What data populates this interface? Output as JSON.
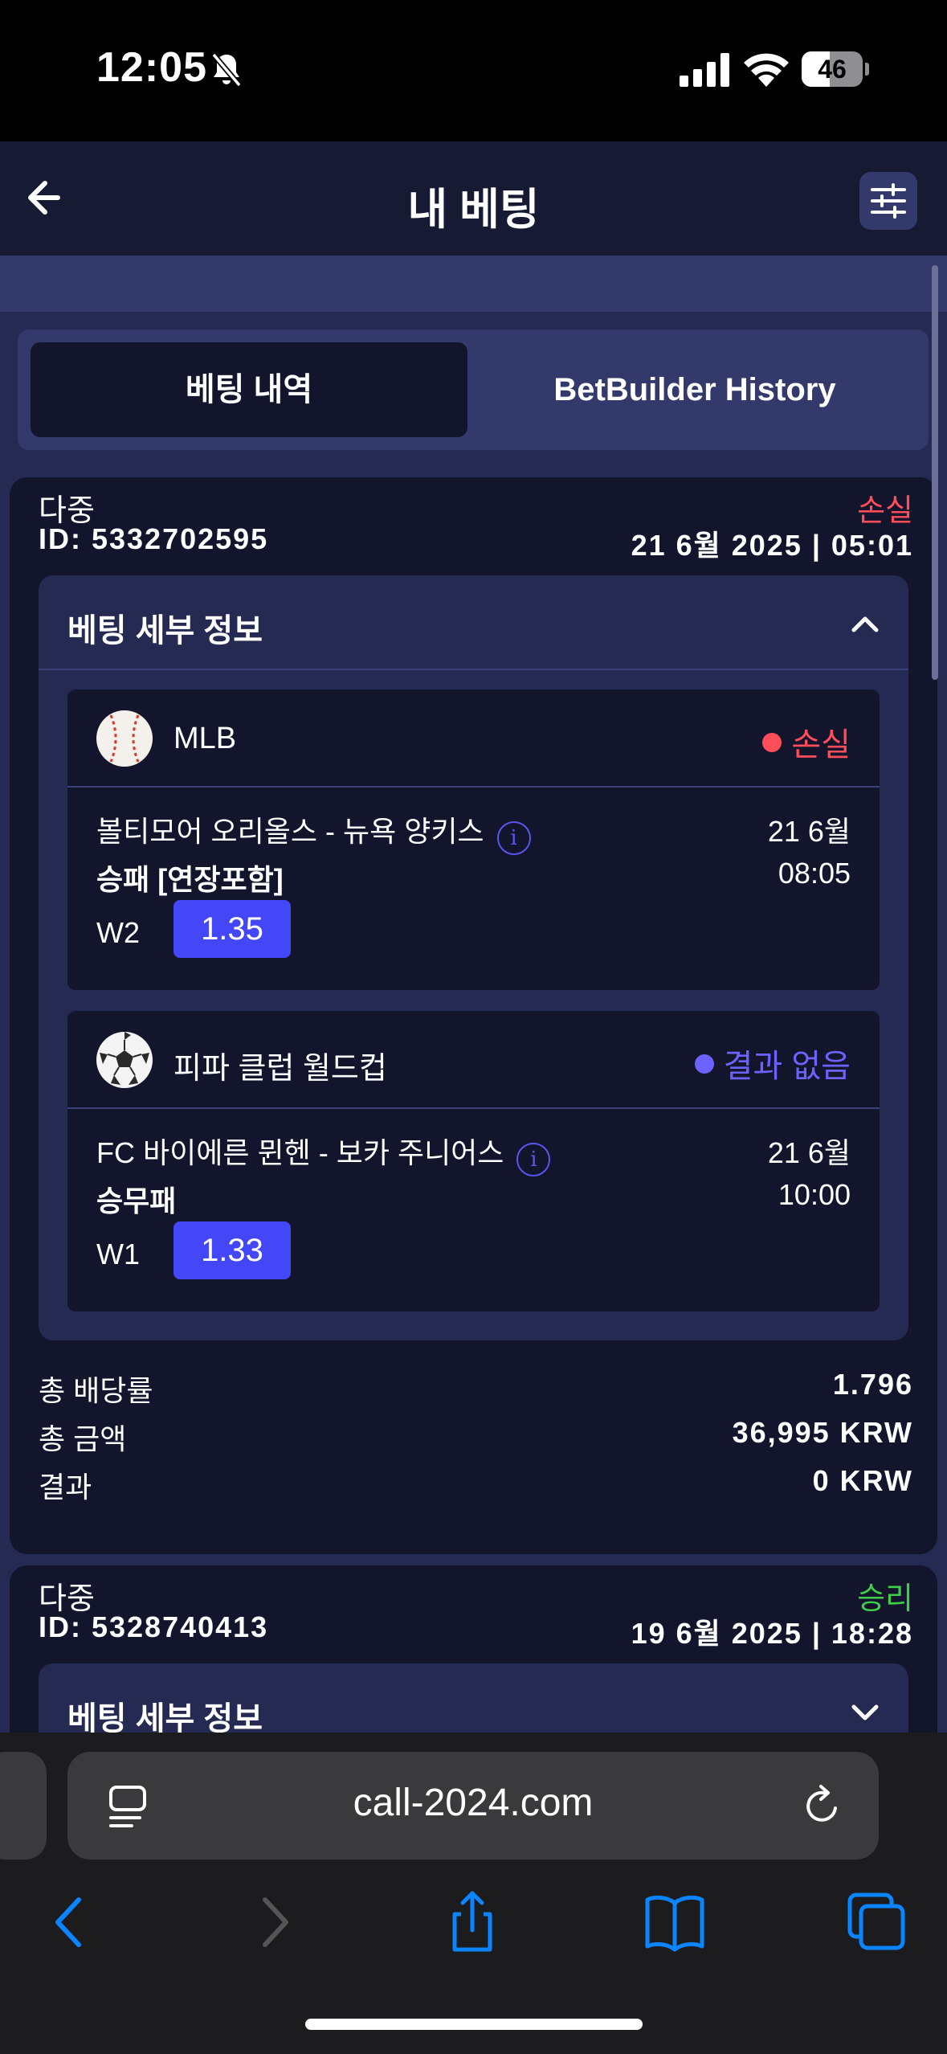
{
  "status_bar": {
    "time": "12:05",
    "battery": "46",
    "battery_level": 0.46
  },
  "header": {
    "title": "내 베팅"
  },
  "tabs": [
    {
      "label": "베팅 내역",
      "active": true
    },
    {
      "label": "BetBuilder History",
      "active": false
    }
  ],
  "bets": [
    {
      "type": "다중",
      "status": "손실",
      "status_color": "#ff4d5a",
      "id": "ID: 5332702595",
      "date": "21 6월 2025 | 05:01",
      "details_title": "베팅 세부 정보",
      "expanded": true,
      "events": [
        {
          "league": "MLB",
          "icon": "baseball-icon",
          "status": "손실",
          "status_color": "#ff4d5a",
          "match": "볼티모어 오리올스 - 뉴욕 양키스",
          "date": "21 6월",
          "market": "승패 [연장포함]",
          "time": "08:05",
          "pick": "W2",
          "odds": "1.35"
        },
        {
          "league": "피파 클럽 월드컵",
          "icon": "soccer-ball-icon",
          "status": "결과 없음",
          "status_color": "#6c63ff",
          "match": "FC 바이에른 뮌헨 - 보카 주니어스",
          "date": "21 6월",
          "market": "승무패",
          "time": "10:00",
          "pick": "W1",
          "odds": "1.33"
        }
      ],
      "summary": [
        {
          "label": "총 배당률",
          "value": "1.796"
        },
        {
          "label": "총 금액",
          "value": "36,995 KRW"
        },
        {
          "label": "결과",
          "value": "0 KRW"
        }
      ]
    },
    {
      "type": "다중",
      "status": "승리",
      "status_color": "#3ecf4a",
      "id": "ID: 5328740413",
      "date": "19 6월 2025 | 18:28",
      "details_title": "베팅 세부 정보",
      "expanded": false
    }
  ],
  "browser": {
    "url": "call-2024.com",
    "accent": "#0a84ff"
  }
}
